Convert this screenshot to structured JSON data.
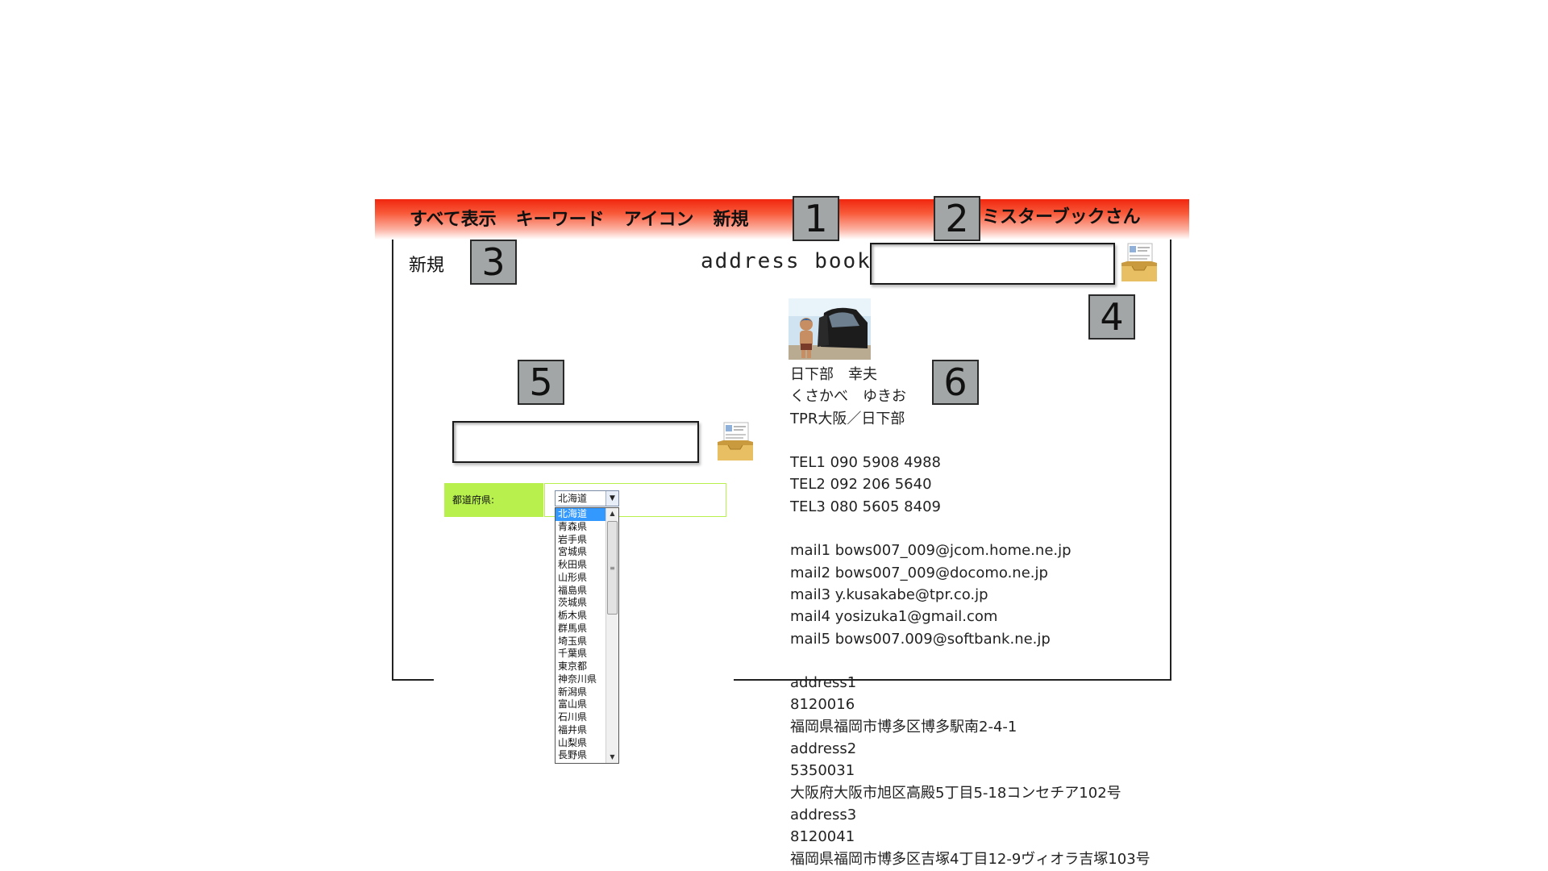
{
  "header": {
    "nav": [
      "すべて表示",
      "キーワード",
      "アイコン",
      "新規"
    ],
    "user": "ミスターブックさん"
  },
  "callouts": [
    "1",
    "2",
    "3",
    "4",
    "5",
    "6"
  ],
  "page": {
    "new_label": "新規",
    "app_title": "address book"
  },
  "form": {
    "prefecture_label": "都道府県:",
    "prefecture_selected": "北海道",
    "prefecture_options": [
      "北海道",
      "青森県",
      "岩手県",
      "宮城県",
      "秋田県",
      "山形県",
      "福島県",
      "茨城県",
      "栃木県",
      "群馬県",
      "埼玉県",
      "千葉県",
      "東京都",
      "神奈川県",
      "新潟県",
      "富山県",
      "石川県",
      "福井県",
      "山梨県",
      "長野県"
    ]
  },
  "contact": {
    "name": "日下部　幸夫",
    "kana": "くさかべ　ゆきお",
    "company": "TPR大阪／日下部",
    "tel1": "TEL1 090 5908 4988",
    "tel2": "TEL2 092 206 5640",
    "tel3": "TEL3 080 5605 8409",
    "mail1": "mail1 bows007_009@jcom.home.ne.jp",
    "mail2": "mail2 bows007_009@docomo.ne.jp",
    "mail3": "mail3 y.kusakabe@tpr.co.jp",
    "mail4": "mail4 yosizuka1@gmail.com",
    "mail5": "mail5 bows007.009@softbank.ne.jp",
    "address1_label": "address1",
    "address1_zip": "8120016",
    "address1": "福岡県福岡市博多区博多駅南2-4-1",
    "address2_label": "address2",
    "address2_zip": "5350031",
    "address2": "大阪府大阪市旭区高殿5丁目5-18コンセチア102号",
    "address3_label": "address3",
    "address3_zip": "8120041",
    "address3": "福岡県福岡市博多区吉塚4丁目12-9ヴィオラ吉塚103号"
  },
  "colors": {
    "header_red": "#f0270f",
    "form_label_green": "#b8f14e",
    "callout_gray": "#a3a6a6",
    "option_selected": "#3399ff"
  },
  "icons": [
    "tray-icon",
    "chevron-down-icon",
    "scroll-up-icon",
    "scroll-down-icon"
  ]
}
